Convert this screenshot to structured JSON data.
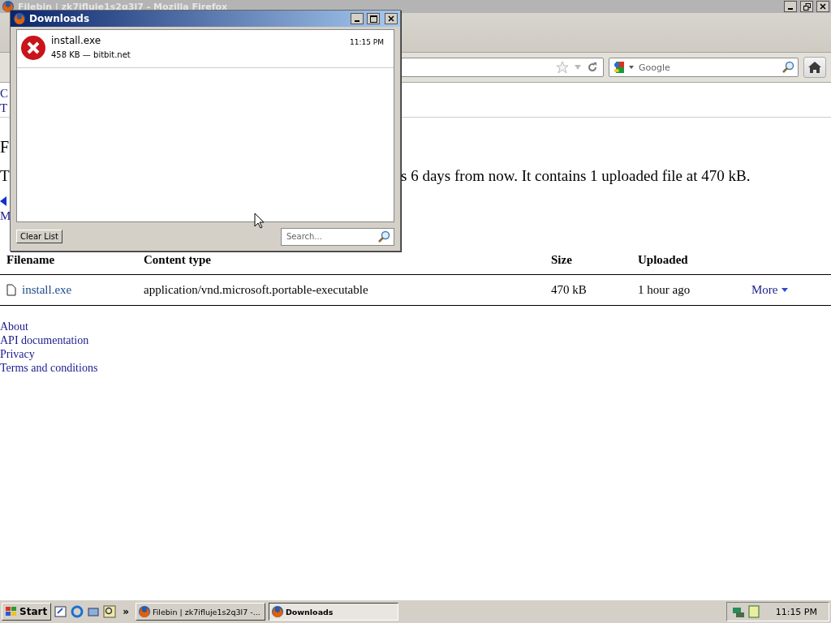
{
  "browser": {
    "title": "Filebin | zk7ifluje1s2q3l7 - Mozilla Firefox",
    "search": {
      "placeholder": "Google"
    }
  },
  "page": {
    "nav_fragments": [
      "C",
      "T"
    ],
    "heading_fragment": "F",
    "paragraph_fragments": [
      "T",
      "s 6 days from now. It contains 1 uploaded file at 470 kB."
    ],
    "link_fragment": "M",
    "table": {
      "columns": [
        "Filename",
        "Content type",
        "Size",
        "Uploaded"
      ],
      "rows": [
        {
          "filename": "install.exe",
          "content_type": "application/vnd.microsoft.portable-executable",
          "size": "470 kB",
          "uploaded": "1 hour ago",
          "action": "More"
        }
      ]
    },
    "footer_links": [
      "About",
      "API documentation",
      "Privacy",
      "Terms and conditions"
    ]
  },
  "downloads_window": {
    "title": "Downloads",
    "items": [
      {
        "name": "install.exe",
        "details": "458 KB — bitbit.net",
        "time": "11:15 PM",
        "kind": "error"
      }
    ],
    "clear_button": "Clear List",
    "search": {
      "placeholder": "Search..."
    }
  },
  "taskbar": {
    "start": "Start",
    "more": "»",
    "tasks": [
      {
        "label": "Filebin | zk7ifluje1s2q3l7 -...",
        "selected": false
      },
      {
        "label": "Downloads",
        "selected": true
      }
    ],
    "clock": "11:15 PM"
  }
}
